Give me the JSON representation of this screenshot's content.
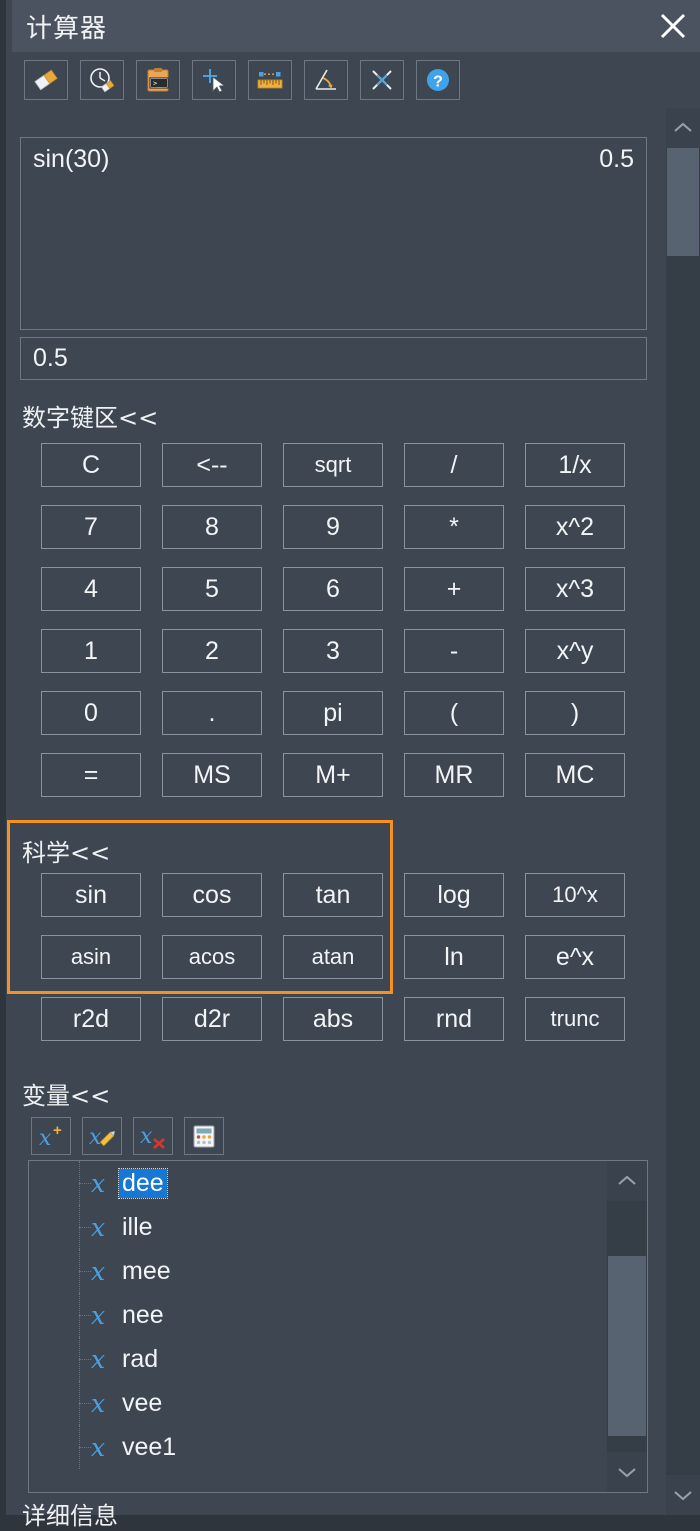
{
  "window": {
    "title": "计算器",
    "close_label": "×"
  },
  "toolbar": {
    "buttons": [
      {
        "name": "clear-history-icon",
        "tip": "eraser"
      },
      {
        "name": "clear-recent-icon",
        "tip": "clock-eraser"
      },
      {
        "name": "paste-to-command-line-icon",
        "tip": "clipboard-console"
      },
      {
        "name": "get-coordinates-icon",
        "tip": "crosshair-cursor"
      },
      {
        "name": "distance-icon",
        "tip": "ruler"
      },
      {
        "name": "angle-icon",
        "tip": "angle"
      },
      {
        "name": "intersection-icon",
        "tip": "x-cross"
      },
      {
        "name": "help-icon",
        "tip": "question-circle"
      }
    ]
  },
  "display": {
    "history": [
      {
        "expression": "sin(30)",
        "result": "0.5"
      }
    ],
    "input_value": "0.5"
  },
  "sections": {
    "numeric_label": "数字键区<<",
    "scientific_label": "科学<<",
    "variables_label": "变量<<",
    "details_label": "详细信息"
  },
  "numeric_keys": [
    [
      "C",
      "<--",
      "sqrt",
      "/",
      "1/x"
    ],
    [
      "7",
      "8",
      "9",
      "*",
      "x^2"
    ],
    [
      "4",
      "5",
      "6",
      "+",
      "x^3"
    ],
    [
      "1",
      "2",
      "3",
      "-",
      "x^y"
    ],
    [
      "0",
      ".",
      "pi",
      "(",
      ")"
    ],
    [
      "=",
      "MS",
      "M+",
      "MR",
      "MC"
    ]
  ],
  "scientific_keys": [
    [
      "sin",
      "cos",
      "tan",
      "log",
      "10^x"
    ],
    [
      "asin",
      "acos",
      "atan",
      "ln",
      "e^x"
    ],
    [
      "r2d",
      "d2r",
      "abs",
      "rnd",
      "trunc"
    ]
  ],
  "variable_toolbar": [
    {
      "name": "new-variable-icon"
    },
    {
      "name": "edit-variable-icon"
    },
    {
      "name": "delete-variable-icon"
    },
    {
      "name": "calculator-icon"
    }
  ],
  "variables": [
    {
      "name": "dee",
      "selected": true
    },
    {
      "name": "ille",
      "selected": false
    },
    {
      "name": "mee",
      "selected": false
    },
    {
      "name": "nee",
      "selected": false
    },
    {
      "name": "rad",
      "selected": false
    },
    {
      "name": "vee",
      "selected": false
    },
    {
      "name": "vee1",
      "selected": false
    }
  ],
  "colors": {
    "panel_bg": "#3d4651",
    "titlebar_bg": "#4a535f",
    "border": "#8a939d",
    "highlight": "#f59023",
    "selection": "#1678d4",
    "variable_glyph": "#4e9fe0",
    "accent_orange": "#f0a030",
    "accent_blue": "#4aa3e0"
  }
}
